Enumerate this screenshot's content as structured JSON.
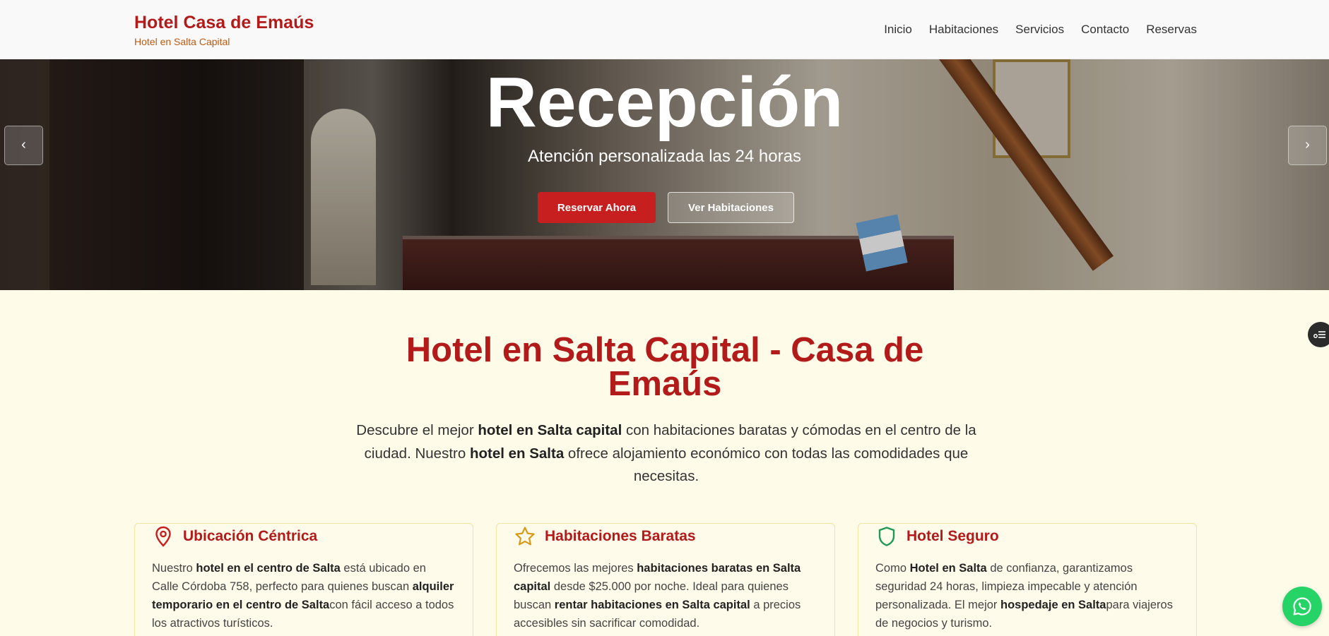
{
  "brand": {
    "title": "Hotel Casa de Emaús",
    "subtitle": "Hotel en Salta Capital"
  },
  "nav": [
    "Inicio",
    "Habitaciones",
    "Servicios",
    "Contacto",
    "Reservas"
  ],
  "hero": {
    "title": "Recepción",
    "subtitle": "Atención personalizada las 24 horas",
    "primary_button": "Reservar Ahora",
    "secondary_button": "Ver Habitaciones",
    "prev_symbol": "‹",
    "next_symbol": "›"
  },
  "intro": {
    "title": "Hotel en Salta Capital - Casa de Emaús",
    "text_parts": [
      "Descubre el mejor ",
      "hotel en Salta capital",
      " con habitaciones baratas y cómodas en el centro de la ciudad. Nuestro ",
      "hotel en Salta",
      " ofrece alojamiento económico con todas las comodidades que necesitas."
    ]
  },
  "cards": [
    {
      "icon": "map-pin-icon",
      "title": "Ubicación Céntrica",
      "text_parts": [
        "Nuestro ",
        "hotel en el centro de Salta",
        " está ubicado en Calle Córdoba 758, perfecto para quienes buscan ",
        "alquiler temporario en el centro de Salta",
        "con fácil acceso a todos los atractivos turísticos."
      ]
    },
    {
      "icon": "star-icon",
      "title": "Habitaciones Baratas",
      "text_parts": [
        "Ofrecemos las mejores ",
        "habitaciones baratas en Salta capital",
        " desde $25.000 por noche. Ideal para quienes buscan ",
        "rentar habitaciones en Salta capital",
        " a precios accesibles sin sacrificar comodidad."
      ]
    },
    {
      "icon": "shield-icon",
      "title": "Hotel Seguro",
      "text_parts": [
        "Como ",
        "Hotel en Salta",
        " de confianza, garantizamos seguridad 24 horas, limpieza impecable y atención personalizada. El mejor ",
        "hospedaje en Salta",
        "para viajeros de negocios y turismo."
      ]
    }
  ],
  "colors": {
    "brand_red": "#b31b1b",
    "button_red": "#c71f1f",
    "page_bg": "#fefbe9",
    "whatsapp_green": "#25d366"
  },
  "floating": {
    "whatsapp_icon": "whatsapp-icon",
    "side_icon": "settings-list-icon"
  }
}
